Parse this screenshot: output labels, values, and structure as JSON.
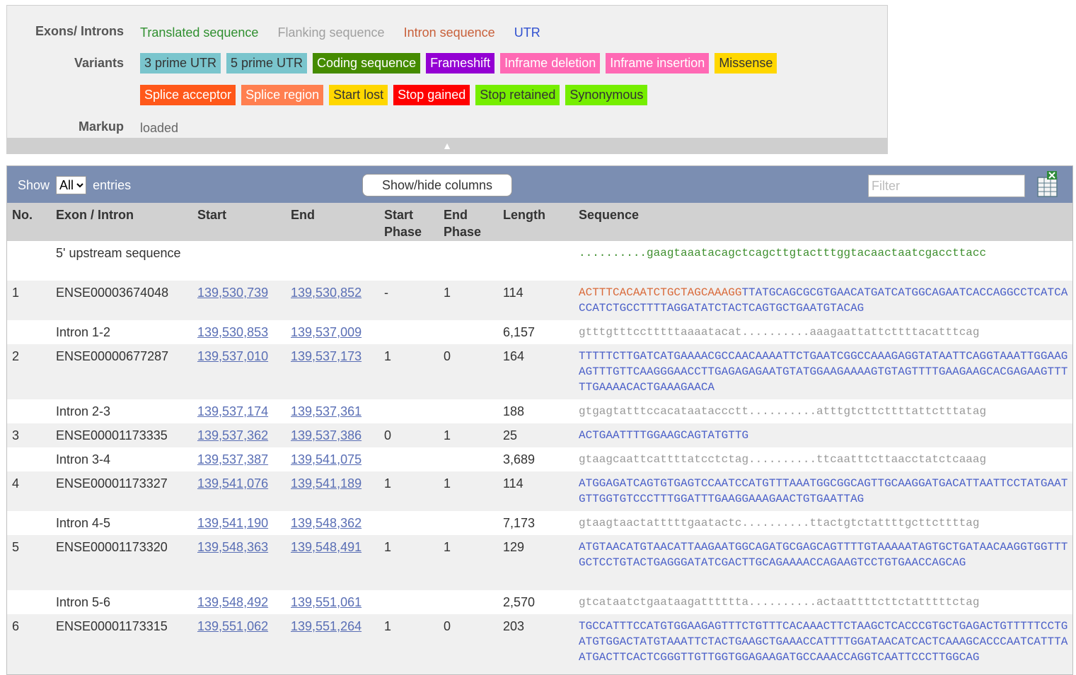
{
  "legend": {
    "exons_label": "Exons/ Introns",
    "exon_types": [
      {
        "label": "Translated sequence",
        "color": "#3050d0"
      },
      {
        "label": "Flanking sequence",
        "color": "#2f8f2f"
      },
      {
        "label": "Intron sequence",
        "color": "#a0a0a0"
      },
      {
        "label": "UTR",
        "color": "#c8603a"
      }
    ],
    "variants_label": "Variants",
    "variants_row1": [
      {
        "label": "3 prime UTR",
        "bg": "#7ac5cd",
        "fg": "#333333"
      },
      {
        "label": "5 prime UTR",
        "bg": "#7ac5cd",
        "fg": "#333333"
      },
      {
        "label": "Coding sequence",
        "bg": "#458b00",
        "fg": "#ffffff"
      },
      {
        "label": "Frameshift",
        "bg": "#9400d3",
        "fg": "#ffffff"
      },
      {
        "label": "Inframe deletion",
        "bg": "#ff69b4",
        "fg": "#ffffff"
      },
      {
        "label": "Inframe insertion",
        "bg": "#ff69b4",
        "fg": "#ffffff"
      },
      {
        "label": "Missense",
        "bg": "#ffd700",
        "fg": "#333333"
      }
    ],
    "variants_row2": [
      {
        "label": "Splice acceptor",
        "bg": "#ff581a",
        "fg": "#ffffff"
      },
      {
        "label": "Splice region",
        "bg": "#ff7f50",
        "fg": "#ffffff"
      },
      {
        "label": "Start lost",
        "bg": "#ffd700",
        "fg": "#333333"
      },
      {
        "label": "Stop gained",
        "bg": "#ff0000",
        "fg": "#ffffff"
      },
      {
        "label": "Stop retained",
        "bg": "#76ee00",
        "fg": "#333333"
      },
      {
        "label": "Synonymous",
        "bg": "#76ee00",
        "fg": "#333333"
      }
    ],
    "markup_label": "Markup",
    "markup_value": "loaded",
    "toggle_icon": "triangle-up-icon"
  },
  "toolbar": {
    "show_label": "Show",
    "entries_label": "entries",
    "show_value": "All",
    "columns_button": "Show/hide columns",
    "filter_placeholder": "Filter",
    "export_icon": "excel-export-icon"
  },
  "columns": {
    "no": "No.",
    "name": "Exon / Intron",
    "start": "Start",
    "end": "End",
    "start_phase": "Start Phase",
    "end_phase": "End Phase",
    "length": "Length",
    "sequence": "Sequence"
  },
  "rows": [
    {
      "no": "",
      "name": "5' upstream sequence",
      "start": "",
      "end": "",
      "sp": "",
      "ep": "",
      "len": "",
      "seq_type": "flank",
      "seq": "..........gaagtaaatacagctcagcttgtactttggtacaactaatcgaccttacc"
    },
    {
      "no": "1",
      "name": "ENSE00003674048",
      "start": "139,530,739",
      "end": "139,530,852",
      "sp": "-",
      "ep": "1",
      "len": "114",
      "seq_type": "exon",
      "utr_prefix": "ACTTTCACAATCTGCTAGCAAAGG",
      "seq": "TTATGCAGCGCGTGAACATGATCATGGCAGAATCACCAGGCCTCATCACCATCTGCCTTTTAGGATATCTACTCAGTGCTGAATGTACAG"
    },
    {
      "no": "",
      "name": "Intron 1-2",
      "start": "139,530,853",
      "end": "139,537,009",
      "sp": "",
      "ep": "",
      "len": "6,157",
      "seq_type": "intron",
      "seq": "gtttgtttcctttttaaaatacat..........aaagaattattcttttacatttcag"
    },
    {
      "no": "2",
      "name": "ENSE00000677287",
      "start": "139,537,010",
      "end": "139,537,173",
      "sp": "1",
      "ep": "0",
      "len": "164",
      "seq_type": "exon",
      "utr_prefix": "",
      "seq": "TTTTTCTTGATCATGAAAACGCCAACAAAATTCTGAATCGGCCAAAGAGGTATAATTCAGGTAAATTGGAAGAGTTTGTTCAAGGGAACCTTGAGAGAGAATGTATGGAAGAAAAGTGTAGTTTTGAAGAAGCACGAGAAGTTTTTGAAAACACTGAAAGAACA"
    },
    {
      "no": "",
      "name": "Intron 2-3",
      "start": "139,537,174",
      "end": "139,537,361",
      "sp": "",
      "ep": "",
      "len": "188",
      "seq_type": "intron",
      "seq": "gtgagtatttccacataataccctt..........atttgtcttcttttattctttatag"
    },
    {
      "no": "3",
      "name": "ENSE00001173335",
      "start": "139,537,362",
      "end": "139,537,386",
      "sp": "0",
      "ep": "1",
      "len": "25",
      "seq_type": "exon",
      "utr_prefix": "",
      "seq": "ACTGAATTTTGGAAGCAGTATGTTG"
    },
    {
      "no": "",
      "name": "Intron 3-4",
      "start": "139,537,387",
      "end": "139,541,075",
      "sp": "",
      "ep": "",
      "len": "3,689",
      "seq_type": "intron",
      "seq": "gtaagcaattcattttatcctctag..........ttcaatttcttaacctatctcaaag"
    },
    {
      "no": "4",
      "name": "ENSE00001173327",
      "start": "139,541,076",
      "end": "139,541,189",
      "sp": "1",
      "ep": "1",
      "len": "114",
      "seq_type": "exon",
      "utr_prefix": "",
      "seq": "ATGGAGATCAGTGTGAGTCCAATCCATGTTTAAATGGCGGCAGTTGCAAGGATGACATTAATTCCTATGAATGTTGGTGTCCCTTTGGATTTGAAGGAAAGAACTGTGAATTAG"
    },
    {
      "no": "",
      "name": "Intron 4-5",
      "start": "139,541,190",
      "end": "139,548,362",
      "sp": "",
      "ep": "",
      "len": "7,173",
      "seq_type": "intron",
      "seq": "gtaagtaactatttttgaatactc..........ttactgtctattttgcttcttttag"
    },
    {
      "no": "5",
      "name": "ENSE00001173320",
      "start": "139,548,363",
      "end": "139,548,491",
      "sp": "1",
      "ep": "1",
      "len": "129",
      "seq_type": "exon",
      "utr_prefix": "",
      "seq": "ATGTAACATGTAACATTAAGAATGGCAGATGCGAGCAGTTTTGTAAAAATAGTGCTGATAACAAGGTGGTTTGCTCCTGTACTGAGGGATATCGACTTGCAGAAAACCAGAAGTCCTGTGAACCAGCAG"
    },
    {
      "no": "",
      "name": "Intron 5-6",
      "start": "139,548,492",
      "end": "139,551,061",
      "sp": "",
      "ep": "",
      "len": "2,570",
      "seq_type": "intron",
      "seq": "gtcataatctgaataagatttttta..........actaattttcttctatttttctag"
    },
    {
      "no": "6",
      "name": "ENSE00001173315",
      "start": "139,551,062",
      "end": "139,551,264",
      "sp": "1",
      "ep": "0",
      "len": "203",
      "seq_type": "exon",
      "utr_prefix": "",
      "seq": "TGCCATTTCCATGTGGAAGAGTTTCTGTTTCACAAACTTCTAAGCTCACCCGTGCTGAGACTGTTTTTCCTGATGTGGACTATGTAAATTCTACTGAAGCTGAAACCATTTTGGATAACATCACTCAAAGCACCCAATCATTTAATGACTTCACTCGGGTTGTTGGTGGAGAAGATGCCAAACCAGGTCAATTCCCTTGGCAG"
    }
  ]
}
